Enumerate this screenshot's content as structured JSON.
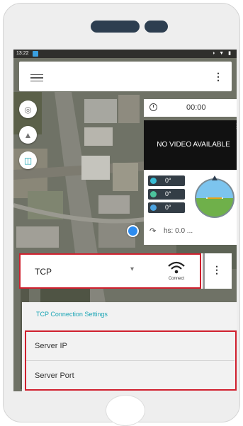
{
  "status_bar": {
    "time": "13:22",
    "icons": "◑ ▼ ▮"
  },
  "toolbar": {
    "menu_icon": "hamburger-menu-icon",
    "overflow_icon": "vertical-dots-icon",
    "overflow_glyph": "⋮"
  },
  "map_controls": {
    "items": [
      {
        "icon": "location-target-icon",
        "glyph": "◎"
      },
      {
        "icon": "navigation-arrow-icon",
        "glyph": "▲"
      },
      {
        "icon": "split-view-icon",
        "glyph": "◫"
      }
    ]
  },
  "timer": {
    "value": "00:00"
  },
  "video": {
    "message": "NO VIDEO AVAILABLE"
  },
  "telemetry": {
    "rows": [
      {
        "icon": "yaw-icon",
        "value": "0°"
      },
      {
        "icon": "pitch-icon",
        "value": "0°"
      },
      {
        "icon": "roll-icon",
        "value": "0°"
      }
    ],
    "hs_icon": "↷",
    "horizontal_speed": "hs: 0.0 ..."
  },
  "connection": {
    "type_selected": "TCP",
    "caret": "▾",
    "connect_label": "Connect",
    "overflow_glyph": "⋮"
  },
  "settings": {
    "title": "TCP Connection Settings",
    "fields": [
      {
        "label": "Server IP"
      },
      {
        "label": "Server Port"
      }
    ]
  },
  "colors": {
    "highlight_red": "#d0202e",
    "accent_teal": "#1aa5b5",
    "phone_dark": "#2d3e50",
    "location_blue": "#2d8cf0"
  }
}
